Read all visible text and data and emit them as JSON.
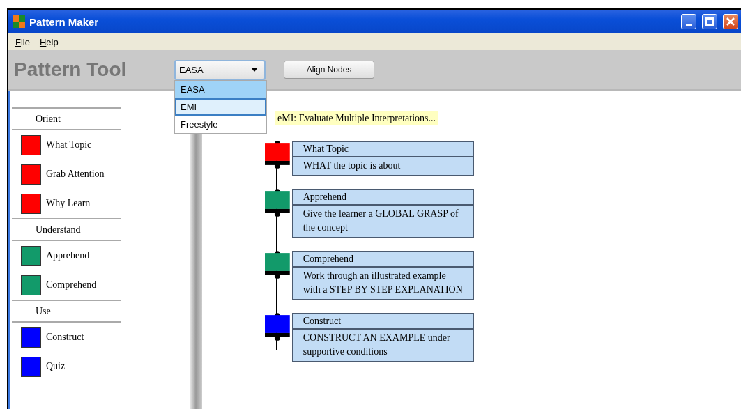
{
  "window": {
    "title": "Pattern Maker"
  },
  "menu": [
    "File",
    "Help"
  ],
  "toolbar": {
    "title": "Pattern Tool",
    "pattern_select": {
      "value": "EASA",
      "expanded": true,
      "options": [
        {
          "label": "EASA",
          "selected": true,
          "focused": false
        },
        {
          "label": "EMI",
          "selected": false,
          "focused": true
        },
        {
          "label": "Freestyle",
          "selected": false,
          "focused": false
        }
      ]
    },
    "buttons": [
      "Align Nodes"
    ]
  },
  "palette": [
    {
      "heading": "Orient",
      "items": [
        {
          "label": "What Topic",
          "color": "#ff0000"
        },
        {
          "label": "Grab Attention",
          "color": "#ff0000"
        },
        {
          "label": "Why Learn",
          "color": "#ff0000"
        }
      ]
    },
    {
      "heading": "Understand",
      "items": [
        {
          "label": "Apprehend",
          "color": "#129a6a"
        },
        {
          "label": "Comprehend",
          "color": "#129a6a"
        }
      ]
    },
    {
      "heading": "Use",
      "items": [
        {
          "label": "Construct",
          "color": "#0000ff"
        },
        {
          "label": "Quiz",
          "color": "#0000ff"
        }
      ]
    }
  ],
  "canvas": {
    "note": "eMI: Evaluate Multiple Interpretations...",
    "nodes": [
      {
        "title": "What Topic",
        "description": "WHAT the topic is about",
        "color": "#ff0000"
      },
      {
        "title": "Apprehend",
        "description": "Give the learner a GLOBAL GRASP of the concept",
        "color": "#129a6a"
      },
      {
        "title": "Comprehend",
        "description": "Work through an illustrated example with a STEP BY STEP EXPLANATION",
        "color": "#129a6a"
      },
      {
        "title": "Construct",
        "description": "CONSTRUCT AN EXAMPLE under supportive conditions",
        "color": "#0000ff"
      }
    ]
  }
}
